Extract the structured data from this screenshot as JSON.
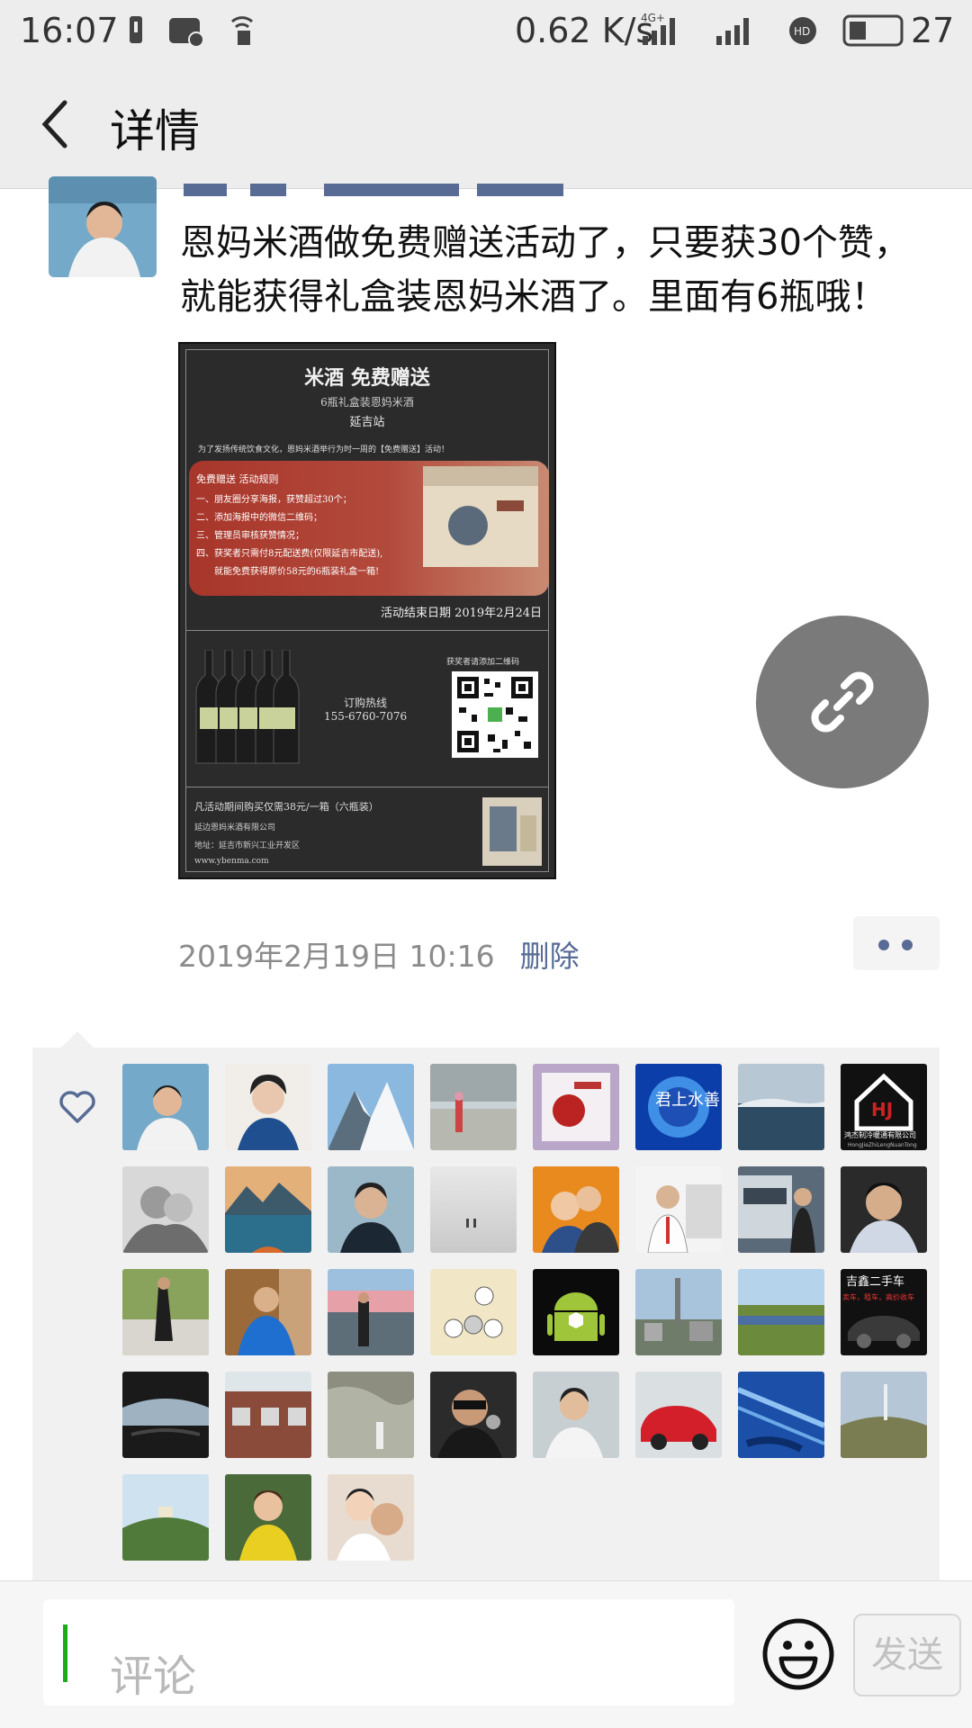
{
  "status_bar": {
    "time": "16:07",
    "net_speed": "0.62 K/s",
    "network": "4G+",
    "battery": "27"
  },
  "header": {
    "back_icon": "chevron-left-icon",
    "title": "详情"
  },
  "post": {
    "text_line1": "恩妈米酒做免费赠送活动了，只要获30个赞，",
    "text_line2": "就能获得礼盒装恩妈米酒了。里面有6瓶哦！",
    "timestamp": "2019年2月19日 10:16",
    "delete_label": "删除"
  },
  "poster": {
    "title": "米酒 免费赠送",
    "subtitle": "6瓶礼盒装恩妈米酒",
    "station": "延吉站",
    "intro": "为了发扬传统饮食文化，恩妈米酒举行为时一周的【免费赠送】活动！",
    "rules_title": "免费赠送 活动规则",
    "rules": [
      "一、朋友圈分享海报，获赞超过30个；",
      "二、添加海报中的微信二维码；",
      "三、管理员审核获赞情况；",
      "四、获奖者只需付8元配送费(仅限延吉市配送),",
      "　　就能免费获得原价58元的6瓶装礼盒一箱!"
    ],
    "end_date": "活动结束日期 2019年2月24日",
    "hotline_label": "订购热线",
    "hotline": "155-6760-7076",
    "qr_label": "获奖者请添加二维码",
    "offer": "凡活动期间购买仅需38元/一箱（六瓶装）",
    "company": "延边恩妈米酒有限公司",
    "address": "地址：延吉市新兴工业开发区",
    "website": "www.ybenma.com"
  },
  "likes": {
    "icon": "heart-icon",
    "avatar_labels": {
      "hj_name": "鸿杰制冷暖通有限公司",
      "hj_pinyin": "HongJieZhiLengNuanTong",
      "car_name": "吉鑫二手车",
      "car_tag": "卖车，租车，高价收车",
      "calligraphy": "君上水善"
    }
  },
  "input": {
    "placeholder": "评论",
    "emoji_icon": "smiley-icon",
    "send_label": "发送"
  }
}
